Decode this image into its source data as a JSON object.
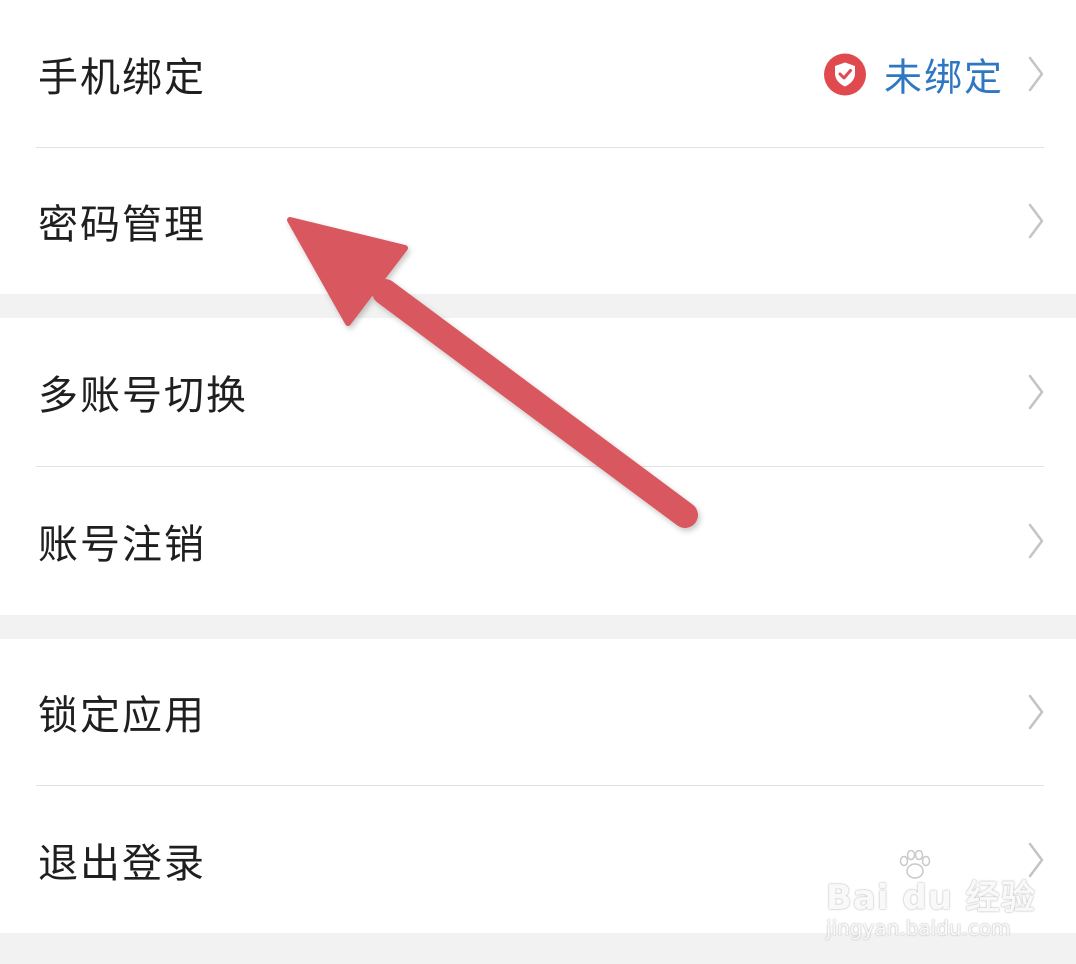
{
  "settings": {
    "items": [
      {
        "label": "手机绑定",
        "status": "未绑定",
        "status_icon": "shield-check-icon"
      },
      {
        "label": "密码管理"
      },
      {
        "label": "多账号切换"
      },
      {
        "label": "账号注销"
      },
      {
        "label": "锁定应用"
      },
      {
        "label": "退出登录"
      }
    ]
  },
  "annotation": {
    "icon": "arrow-pointer-icon",
    "color": "#d9585e"
  },
  "watermark": {
    "main": "Bai du 经验",
    "sub": "jingyan.baidu.com",
    "icon": "paw-icon"
  },
  "colors": {
    "status_text": "#2f77c2",
    "shield": "#e04a4f",
    "background": "#f2f2f2"
  }
}
